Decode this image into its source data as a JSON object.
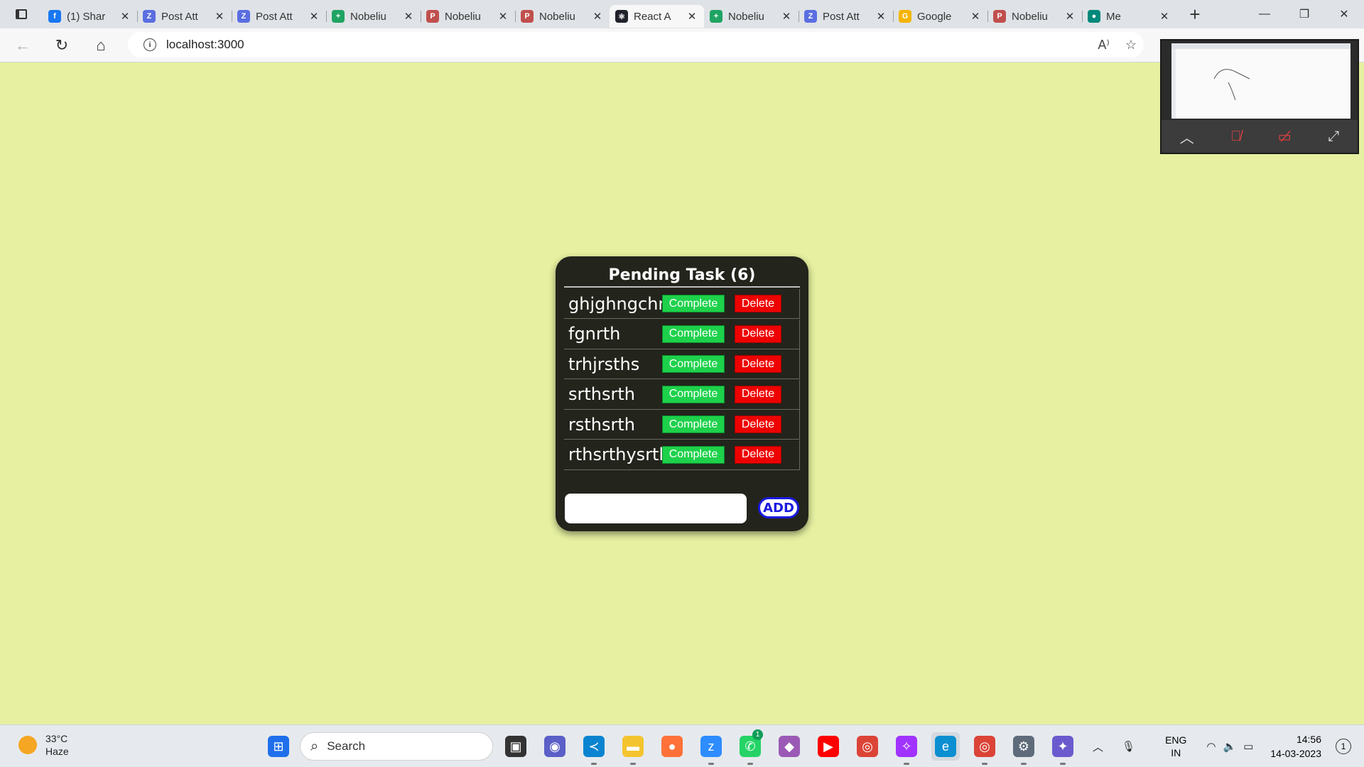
{
  "browser": {
    "tabs": [
      {
        "title": "(1) Shar",
        "favicon": "facebook-icon",
        "color": "#1877f2",
        "glyph": "f"
      },
      {
        "title": "Post Att",
        "favicon": "z-icon",
        "color": "#5b6ee1",
        "glyph": "Z"
      },
      {
        "title": "Post Att",
        "favicon": "z-icon",
        "color": "#5b6ee1",
        "glyph": "Z"
      },
      {
        "title": "Nobeliu",
        "favicon": "sheets-icon",
        "color": "#1fa463",
        "glyph": "+"
      },
      {
        "title": "Nobeliu",
        "favicon": "pdf-icon",
        "color": "#c0504d",
        "glyph": "P"
      },
      {
        "title": "Nobeliu",
        "favicon": "pdf-icon",
        "color": "#c0504d",
        "glyph": "P"
      },
      {
        "title": "React A",
        "favicon": "react-icon",
        "color": "#20232a",
        "glyph": "⚛",
        "active": true
      },
      {
        "title": "Nobeliu",
        "favicon": "sheets-icon",
        "color": "#1fa463",
        "glyph": "+"
      },
      {
        "title": "Post Att",
        "favicon": "z-icon",
        "color": "#5b6ee1",
        "glyph": "Z"
      },
      {
        "title": "Google",
        "favicon": "google-slides-icon",
        "color": "#f4b400",
        "glyph": "G"
      },
      {
        "title": "Nobeliu",
        "favicon": "pdf-icon",
        "color": "#c0504d",
        "glyph": "P"
      },
      {
        "title": "Me",
        "favicon": "meet-icon",
        "color": "#00897b",
        "glyph": "●"
      }
    ],
    "url": "localhost:3000"
  },
  "todo": {
    "title": "Pending Task (6)",
    "complete_label": "Complete",
    "delete_label": "Delete",
    "add_label": "ADD",
    "input_value": "",
    "tasks": [
      "ghjghngchn",
      "fgnrth",
      "trhjrsths",
      "srthsrth",
      "rsthsrth",
      "rthsrthysrth"
    ]
  },
  "colors": {
    "page_bg": "#e6f0a0",
    "card_bg": "#23241c",
    "complete": "#1ed14b",
    "delete": "#ee0000",
    "add": "#1a1ae0"
  },
  "taskbar": {
    "weather_temp": "33°C",
    "weather_desc": "Haze",
    "search_placeholder": "Search",
    "lang_top": "ENG",
    "lang_bottom": "IN",
    "time": "14:56",
    "date": "14-03-2023",
    "notification_count": "1",
    "whatsapp_badge": "1",
    "apps": [
      {
        "name": "windows-start-icon",
        "color": "#1f6feb",
        "glyph": "⊞"
      },
      {
        "name": "task-view-icon",
        "color": "#333333",
        "glyph": "▣"
      },
      {
        "name": "teams-chat-icon",
        "color": "#5b5fc7",
        "glyph": "◉"
      },
      {
        "name": "vscode-icon",
        "color": "#0a84d0",
        "glyph": "≺"
      },
      {
        "name": "file-explorer-icon",
        "color": "#f4c430",
        "glyph": "▬"
      },
      {
        "name": "firefox-icon",
        "color": "#ff7139",
        "glyph": "●"
      },
      {
        "name": "zoom-icon",
        "color": "#2d8cff",
        "glyph": "z"
      },
      {
        "name": "whatsapp-icon",
        "color": "#25d366",
        "glyph": "✆"
      },
      {
        "name": "git-app-icon",
        "color": "#9b59b6",
        "glyph": "◆"
      },
      {
        "name": "youtube-icon",
        "color": "#ff0000",
        "glyph": "▶"
      },
      {
        "name": "chrome-icon",
        "color": "#db4437",
        "glyph": "◎"
      },
      {
        "name": "messenger-icon",
        "color": "#a033ff",
        "glyph": "✧"
      },
      {
        "name": "edge-icon",
        "color": "#0c8fd1",
        "glyph": "e"
      },
      {
        "name": "chrome-profile-icon",
        "color": "#db4437",
        "glyph": "◎"
      },
      {
        "name": "settings-icon",
        "color": "#5f6b7a",
        "glyph": "⚙"
      },
      {
        "name": "copilot-icon",
        "color": "#6a5acd",
        "glyph": "✦"
      }
    ]
  }
}
